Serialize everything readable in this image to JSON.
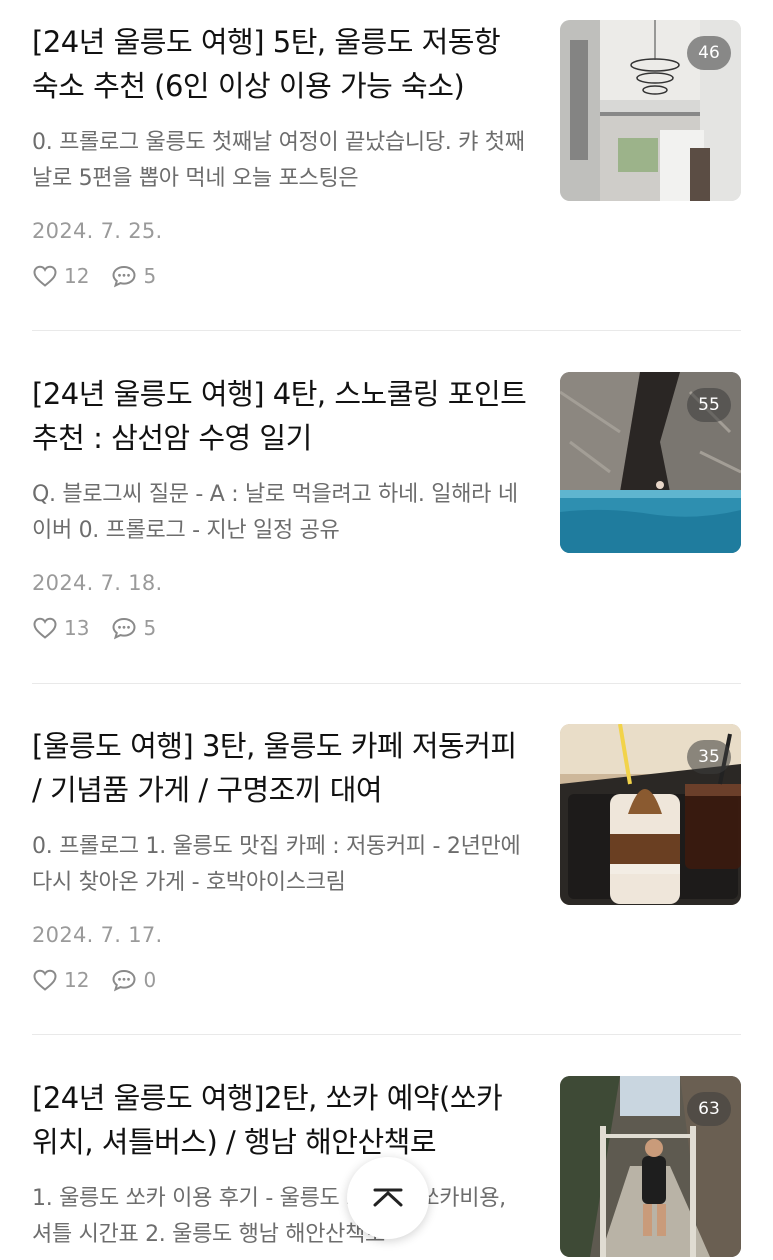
{
  "posts": [
    {
      "title": "[24년 울릉도 여행] 5탄, 울릉도 저동항 숙소 추천 (6인 이상 이용 가능 숙소)",
      "excerpt": "0. 프롤로그 울릉도 첫째날 여정이 끝났습니당. 캬 첫째날로 5편을 뽑아 먹네 오늘 포스팅은",
      "date": "2024. 7. 25.",
      "likes": "12",
      "comments": "5",
      "photo_count": "46"
    },
    {
      "title": "[24년 울릉도 여행] 4탄, 스노쿨링 포인트 추천 : 삼선암 수영 일기",
      "excerpt": "Q. 블로그씨 질문 - A : 날로 먹을려고 하네. 일해라 네이버 0. 프롤로그 - 지난 일정 공유",
      "date": "2024. 7. 18.",
      "likes": "13",
      "comments": "5",
      "photo_count": "55"
    },
    {
      "title": "[울릉도 여행] 3탄, 울릉도 카페 저동커피 / 기념품 가게 / 구명조끼 대여",
      "excerpt": "0. 프롤로그 1. 울릉도 맛집 카페 : 저동커피 - 2년만에 다시 찾아온 가게 - 호박아이스크림",
      "date": "2024. 7. 17.",
      "likes": "12",
      "comments": "0",
      "photo_count": "35"
    },
    {
      "title": "[24년 울릉도 여행]2탄, 쏘카 예약(쏘카 위치, 셔틀버스) / 행남 해안산책로",
      "excerpt": "1. 울릉도 쏘카 이용 후기 - 울릉도 쏘카존, 쏘카비용, 셔틀 시간표 2. 울릉도 행남 해안산책로",
      "date": "",
      "likes": "",
      "comments": "",
      "photo_count": "63"
    }
  ],
  "colors": {
    "title": "#111111",
    "excerpt": "#6d6d6d",
    "meta": "#9a9a9a",
    "divider": "#e9e9e9"
  },
  "icons": {
    "like": "heart-outline-icon",
    "comment": "speech-bubble-icon",
    "scroll_top": "chevron-up-icon"
  }
}
